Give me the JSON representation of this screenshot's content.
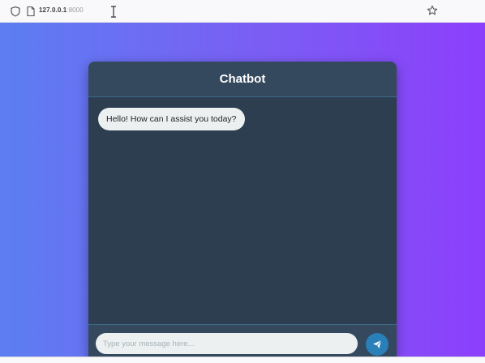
{
  "browser": {
    "url_host": "127.0.0.1",
    "url_port": ":8000",
    "icons": [
      "shield-icon",
      "page-icon",
      "star-icon"
    ]
  },
  "chat": {
    "title": "Chatbot",
    "messages": [
      {
        "sender": "bot",
        "text": "Hello! How can I assist you today?"
      }
    ],
    "input": {
      "placeholder": "Type your message here...",
      "value": ""
    },
    "send_icon": "paper-plane-icon"
  },
  "colors": {
    "gradient_start": "#5c7ef2",
    "gradient_end": "#8c3ffb",
    "chat_bg": "#2c3e50",
    "header_bg": "#34495e",
    "bubble_bg": "#ecf0f1",
    "send_button": "#2980b9"
  }
}
